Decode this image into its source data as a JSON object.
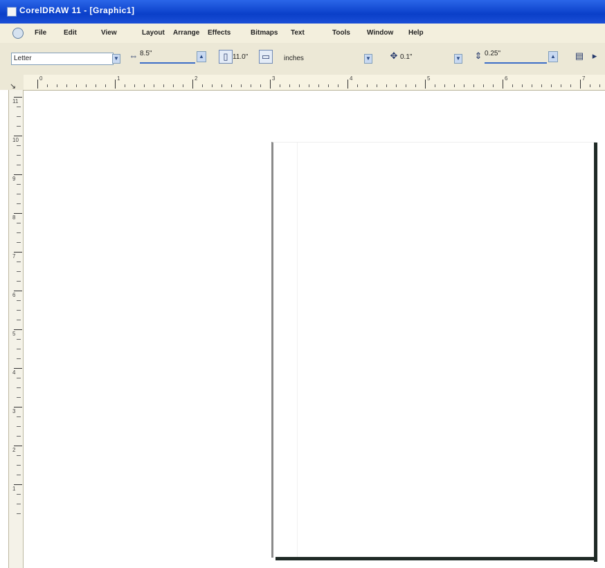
{
  "window": {
    "title": "CorelDRAW 11 - [Graphic1]"
  },
  "menu": {
    "items": [
      "File",
      "Edit",
      "View",
      "Layout",
      "Arrange",
      "Effects",
      "Bitmaps",
      "Text",
      "Tools",
      "Window",
      "Help"
    ]
  },
  "toolbar": {
    "paper_type": "Letter",
    "width_label": "8.5\"",
    "height_label": "11.0\"",
    "units": "inches",
    "nudge": "0.1\"",
    "duplicate_distance": "0.25\""
  },
  "ruler": {
    "h_numbers": [
      "0",
      "1",
      "2",
      "3",
      "4",
      "5",
      "6",
      "7"
    ],
    "v_numbers": [
      "11",
      "10",
      "9",
      "8",
      "7",
      "6",
      "5",
      "4",
      "3",
      "2",
      "1"
    ]
  },
  "colors": {
    "titlebar": "#0a3fc9",
    "menubar": "#f3efdd",
    "toolbar": "#ece8d6",
    "page_shadow": "#1f2a26",
    "page_border": "#8a8a8a"
  },
  "icons": {
    "app": "coreldraw-icon",
    "system": "document-icon"
  }
}
